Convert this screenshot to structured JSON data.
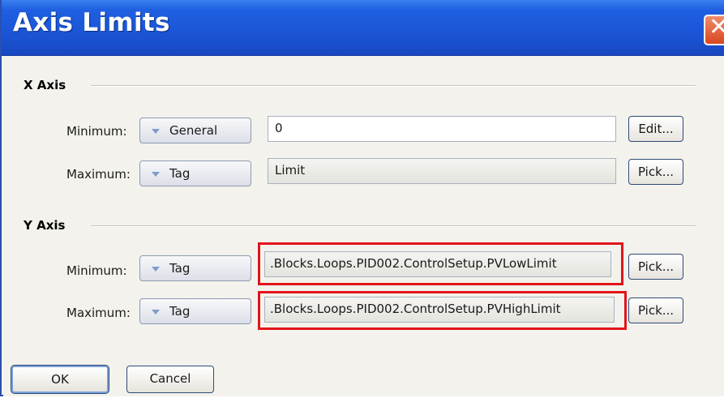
{
  "window": {
    "title": "Axis Limits",
    "close_glyph": "✕"
  },
  "x_axis": {
    "label": "X Axis",
    "minimum": {
      "label": "Minimum:",
      "type": "General",
      "value": "0",
      "button": "Edit..."
    },
    "maximum": {
      "label": "Maximum:",
      "type": "Tag",
      "value": "Limit",
      "button": "Pick..."
    }
  },
  "y_axis": {
    "label": "Y Axis",
    "minimum": {
      "label": "Minimum:",
      "type": "Tag",
      "value": ".Blocks.Loops.PID002.ControlSetup.PVLowLimit",
      "button": "Pick..."
    },
    "maximum": {
      "label": "Maximum:",
      "type": "Tag",
      "value": ".Blocks.Loops.PID002.ControlSetup.PVHighLimit",
      "button": "Pick..."
    }
  },
  "footer": {
    "ok": "OK",
    "cancel": "Cancel"
  },
  "colors": {
    "titlebar": "#1f5fe0",
    "highlight": "#e2141b",
    "dialog_bg": "#f3f2ec"
  }
}
